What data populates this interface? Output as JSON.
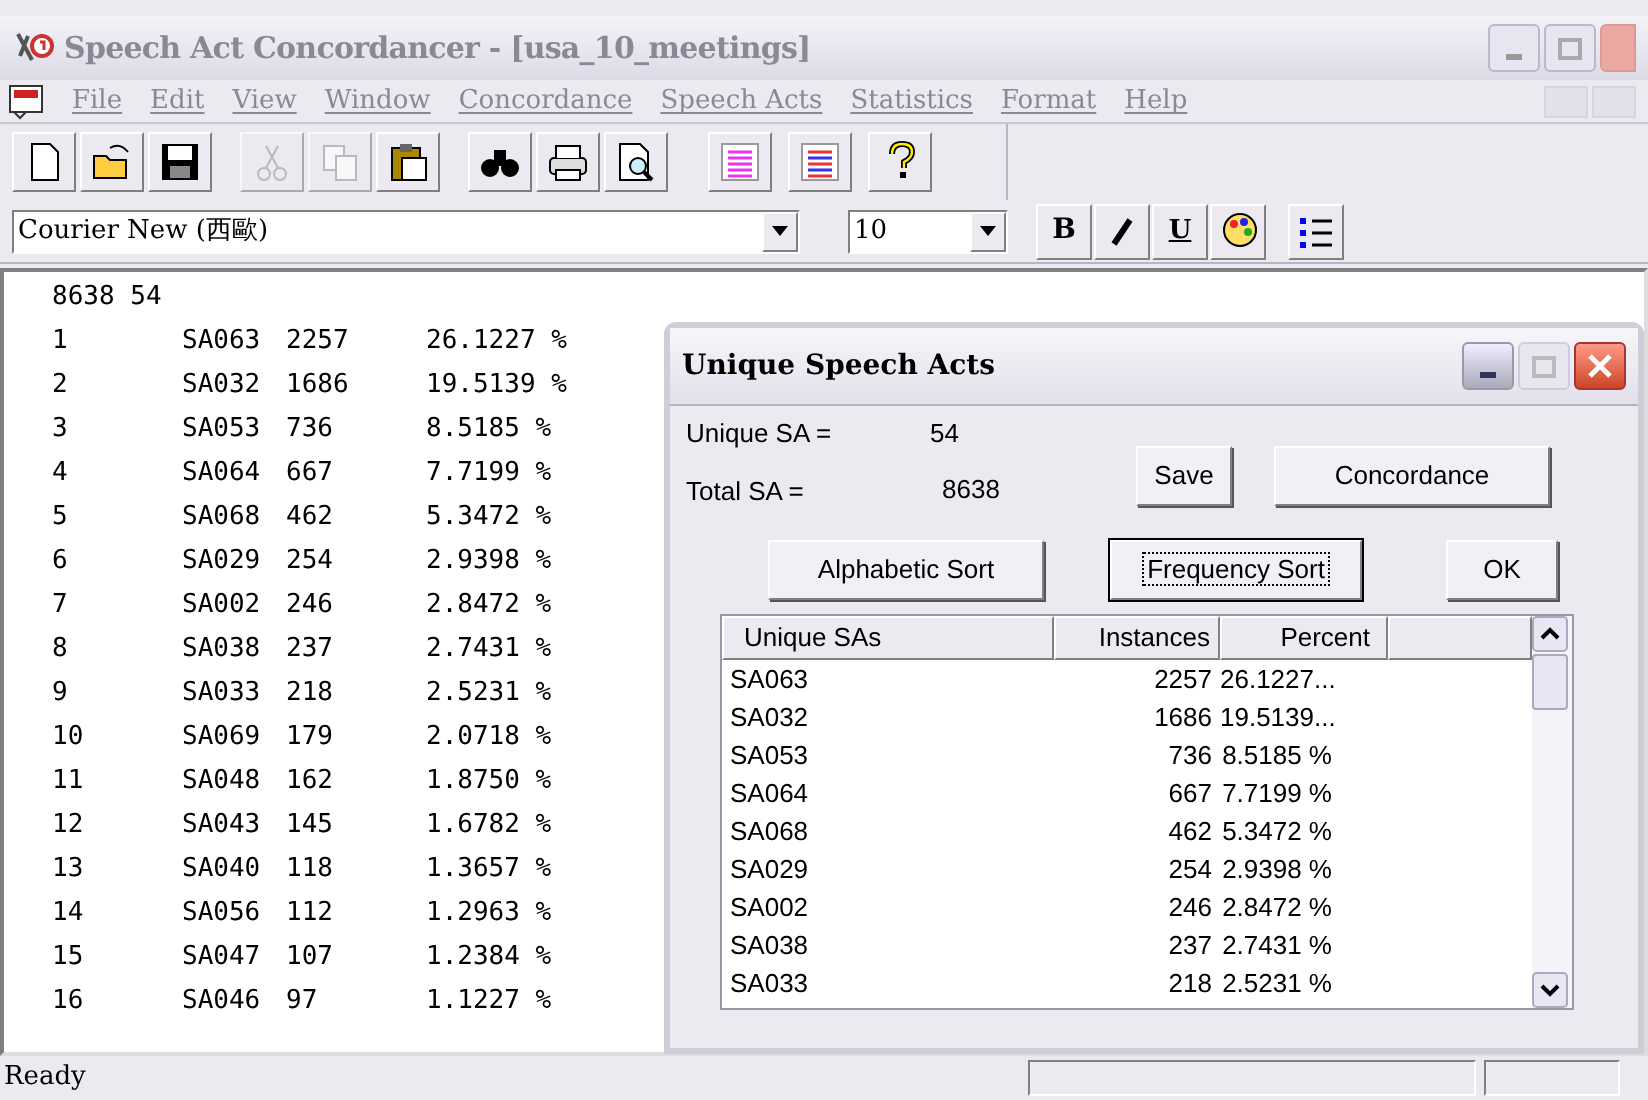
{
  "window": {
    "title": "Speech Act Concordancer - [usa_10_meetings]"
  },
  "menu": [
    "File",
    "Edit",
    "View",
    "Window",
    "Concordance",
    "Speech Acts",
    "Statistics",
    "Format",
    "Help"
  ],
  "toolbar": [
    {
      "kind": "new",
      "disabled": false
    },
    {
      "kind": "open",
      "disabled": false
    },
    {
      "kind": "save",
      "disabled": false
    },
    {
      "kind": "sep"
    },
    {
      "kind": "cut",
      "disabled": true
    },
    {
      "kind": "copy",
      "disabled": true
    },
    {
      "kind": "paste",
      "disabled": false
    },
    {
      "kind": "sep"
    },
    {
      "kind": "find",
      "disabled": false
    },
    {
      "kind": "print",
      "disabled": false
    },
    {
      "kind": "preview",
      "disabled": false
    },
    {
      "kind": "sep"
    },
    {
      "kind": "list1",
      "disabled": false
    },
    {
      "kind": "list2",
      "disabled": false
    },
    {
      "kind": "help",
      "disabled": false
    }
  ],
  "format_bar": {
    "font": "Courier New (西歐)",
    "size": "10",
    "buttons": [
      {
        "kind": "bold",
        "label": "B"
      },
      {
        "kind": "italic"
      },
      {
        "kind": "underline",
        "label": "U"
      },
      {
        "kind": "palette"
      },
      {
        "kind": "bullets"
      }
    ]
  },
  "editor": {
    "header": "8638 54",
    "rows": [
      [
        "1",
        "SA063",
        "2257",
        "26.1227 %"
      ],
      [
        "2",
        "SA032",
        "1686",
        "19.5139 %"
      ],
      [
        "3",
        "SA053",
        "736",
        "8.5185 %"
      ],
      [
        "4",
        "SA064",
        "667",
        "7.7199 %"
      ],
      [
        "5",
        "SA068",
        "462",
        "5.3472 %"
      ],
      [
        "6",
        "SA029",
        "254",
        "2.9398 %"
      ],
      [
        "7",
        "SA002",
        "246",
        "2.8472 %"
      ],
      [
        "8",
        "SA038",
        "237",
        "2.7431 %"
      ],
      [
        "9",
        "SA033",
        "218",
        "2.5231 %"
      ],
      [
        "10",
        "SA069",
        "179",
        "2.0718 %"
      ],
      [
        "11",
        "SA048",
        "162",
        "1.8750 %"
      ],
      [
        "12",
        "SA043",
        "145",
        "1.6782 %"
      ],
      [
        "13",
        "SA040",
        "118",
        "1.3657 %"
      ],
      [
        "14",
        "SA056",
        "112",
        "1.2963 %"
      ],
      [
        "15",
        "SA047",
        "107",
        "1.2384 %"
      ],
      [
        "16",
        "SA046",
        "97",
        "1.1227 %"
      ]
    ]
  },
  "dialog": {
    "title": "Unique Speech Acts",
    "unique_label": "Unique SA =",
    "unique_value": "54",
    "total_label": "Total SA =",
    "total_value": "8638",
    "buttons": [
      {
        "label": "Save",
        "focused": false
      },
      {
        "label": "Concordance",
        "focused": false
      },
      {
        "label": "Alphabetic Sort",
        "focused": false
      },
      {
        "label": "Frequency Sort",
        "focused": true
      },
      {
        "label": "OK",
        "focused": false
      }
    ],
    "list": {
      "columns": [
        "Unique SAs",
        "Instances",
        "Percent"
      ],
      "rows": [
        [
          "SA063",
          "2257",
          "26.1227..."
        ],
        [
          "SA032",
          "1686",
          "19.5139..."
        ],
        [
          "SA053",
          "736",
          "8.5185 %"
        ],
        [
          "SA064",
          "667",
          "7.7199 %"
        ],
        [
          "SA068",
          "462",
          "5.3472 %"
        ],
        [
          "SA029",
          "254",
          "2.9398 %"
        ],
        [
          "SA002",
          "246",
          "2.8472 %"
        ],
        [
          "SA038",
          "237",
          "2.7431 %"
        ],
        [
          "SA033",
          "218",
          "2.5231 %"
        ]
      ]
    }
  },
  "status_bar": {
    "text": "Ready"
  }
}
